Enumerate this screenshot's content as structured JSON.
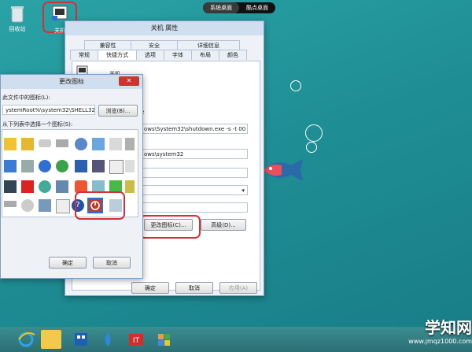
{
  "topbar": {
    "left": "系统桌面",
    "right": "酷点桌面"
  },
  "desktop_icons": [
    {
      "label": "回收站",
      "icon": "recycle-bin-icon"
    },
    {
      "label": "关机",
      "icon": "shutdown-shortcut-icon"
    }
  ],
  "properties": {
    "title": "关机 属性",
    "tabs_row1": [
      "兼容性",
      "安全",
      "详细信息"
    ],
    "tabs_row2": [
      "常规",
      "快捷方式",
      "选项",
      "字体",
      "布局",
      "颜色"
    ],
    "name_partial": "关机",
    "number_fragment": "2",
    "target_value": "ows\\System32\\shutdown.exe -s -t 00",
    "start_in_value": "ows\\system32",
    "change_icon_button": "更改图标(C)...",
    "advanced_button": "高级(D)...",
    "ok": "确定",
    "cancel": "取消",
    "apply": "应用(A)"
  },
  "change_icon": {
    "title": "更改图标",
    "file_label": "此文件中的图标(L):",
    "file_value": "ystemRoot%\\system32\\SHELL32.",
    "browse": "浏览(B)...",
    "list_label": "从下列表中选择一个图标(S):",
    "ok": "确定",
    "cancel": "取消",
    "close": "✕"
  },
  "taskbar": {
    "icons": [
      "ie-icon",
      "explorer-icon",
      "store-icon",
      "water-drop-icon",
      "it-app-icon",
      "puzzle-app-icon"
    ]
  },
  "watermark": {
    "brand": "学知网",
    "url": "www.jmqz1000.com"
  },
  "colors": {
    "accent_red": "#d3303a",
    "desktop": "#1f8f95"
  }
}
